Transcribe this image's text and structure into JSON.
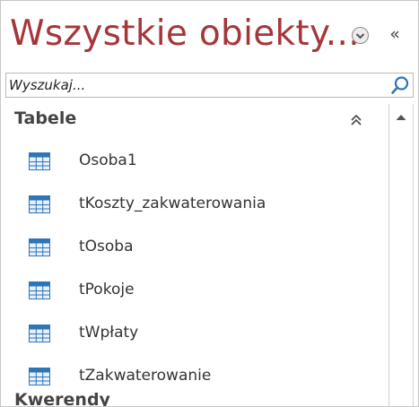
{
  "pane": {
    "title": "Wszystkie obiekty...",
    "collapse_label": "«",
    "search": {
      "placeholder": "Wyszukaj..."
    },
    "groups": [
      {
        "label": "Tabele",
        "items": [
          {
            "label": "Osoba1",
            "icon": "table-icon"
          },
          {
            "label": "tKoszty_zakwaterowania",
            "icon": "table-icon"
          },
          {
            "label": "tOsoba",
            "icon": "table-icon"
          },
          {
            "label": "tPokoje",
            "icon": "table-icon"
          },
          {
            "label": "tWpłaty",
            "icon": "table-icon"
          },
          {
            "label": "tZakwaterowanie",
            "icon": "table-icon"
          }
        ]
      },
      {
        "label": "Kwerendy"
      }
    ]
  },
  "colors": {
    "title": "#a4373a",
    "icon_blue": "#2e75b6",
    "text": "#333333"
  }
}
